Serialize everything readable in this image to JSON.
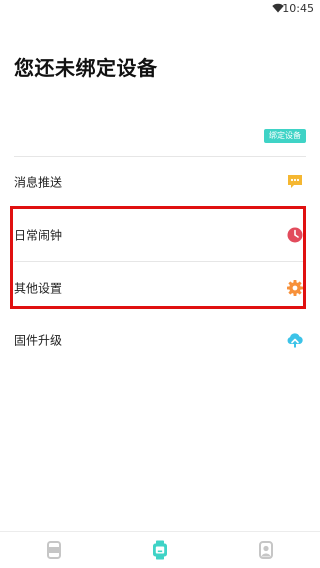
{
  "status": {
    "time": "10:45"
  },
  "title": "您还未绑定设备",
  "bind_button": "绑定设备",
  "menu": [
    {
      "label": "消息推送",
      "icon": "message-icon"
    },
    {
      "label": "日常闹钟",
      "icon": "alarm-clock-icon"
    },
    {
      "label": "其他设置",
      "icon": "settings-gear-icon"
    },
    {
      "label": "固件升级",
      "icon": "firmware-upgrade-icon"
    }
  ],
  "colors": {
    "accent": "#3fd3c6",
    "message_icon": "#f5b731",
    "alarm_icon": "#e24b5c",
    "settings_icon": "#f7913b",
    "firmware_icon": "#3cc3e8",
    "highlight": "#e01010"
  },
  "tabs": [
    {
      "icon": "device-list-icon",
      "active": false
    },
    {
      "icon": "watch-icon",
      "active": true
    },
    {
      "icon": "profile-icon",
      "active": false
    }
  ]
}
